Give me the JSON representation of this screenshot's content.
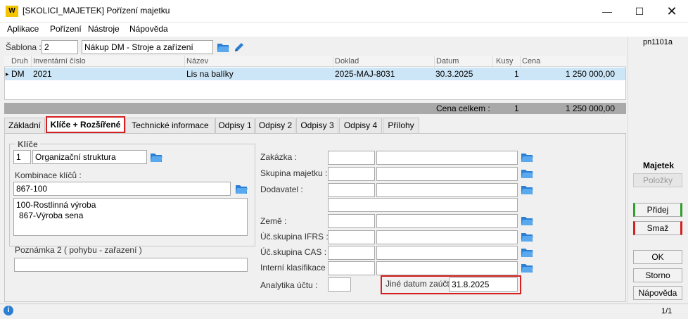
{
  "window": {
    "title": "[SKOLICI_MAJETEK] Pořízení majetku",
    "logo": "W",
    "code": "pn1101a"
  },
  "menu": [
    "Aplikace",
    "Pořízení",
    "Nástroje",
    "Nápověda"
  ],
  "template": {
    "label": "Šablona :",
    "number": "2",
    "name": "Nákup DM - Stroje a zařízení"
  },
  "grid": {
    "headers": [
      "Druh",
      "Inventární číslo",
      "Název",
      "Doklad",
      "Datum",
      "Kusy",
      "Cena"
    ],
    "row": {
      "marker": "▸",
      "druh": "DM",
      "inv": "2021",
      "nazev": "Lis na balíky",
      "doklad": "2025-MAJ-8031",
      "datum": "30.3.2025",
      "kusy": "1",
      "cena": "1 250 000,00"
    },
    "total_label": "Cena celkem :",
    "total_kusy": "1",
    "total_cena": "1 250 000,00"
  },
  "tabs": [
    "Základní",
    "Klíče + Rozšířené",
    "Technické informace",
    "Odpisy 1",
    "Odpisy 2",
    "Odpisy 3",
    "Odpisy 4",
    "Přílohy"
  ],
  "keys": {
    "group_title": "Klíče",
    "number": "1",
    "name": "Organizační struktura",
    "combination_label": "Kombinace klíčů :",
    "combination_value": "867-100",
    "description_line1": "100-Rostlinná výroba",
    "description_line2": "867-Výroba sena",
    "note_label": "Poznámka 2 ( pohybu - zařazení )",
    "note_value": ""
  },
  "fields": {
    "zakazka": "Zakázka :",
    "skupina": "Skupina majetku :",
    "dodavatel": "Dodavatel :",
    "zeme": "Země :",
    "ifrs": "Úč.skupina IFRS :",
    "cas": "Úč.skupina CAS :",
    "interni": "Interní klasifikace :",
    "analytika": "Analytika účtu :",
    "jine_datum_label": "Jiné datum zaúčt. :",
    "jine_datum_value": "31.8.2025"
  },
  "side": {
    "section": "Majetek",
    "polozky": "Položky",
    "pridej": "Přidej",
    "smaz": "Smaž",
    "ok": "OK",
    "storno": "Storno",
    "napoveda": "Nápověda"
  },
  "status": {
    "page": "1/1"
  },
  "colors": {
    "highlight_red": "#d42020",
    "selected_row": "#cde6f7",
    "add_green": "#2e9e2e",
    "delete_red": "#d42020"
  }
}
